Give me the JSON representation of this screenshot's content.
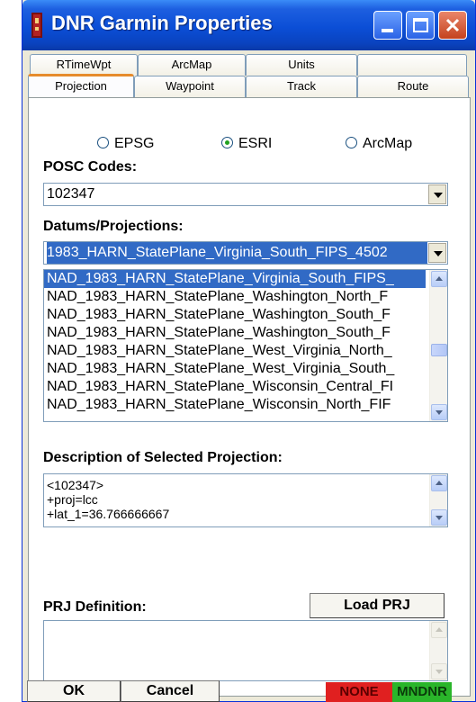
{
  "window": {
    "title": "DNR Garmin Properties"
  },
  "tabs": {
    "back_row": [
      {
        "label": "RTimeWpt"
      },
      {
        "label": "ArcMap"
      },
      {
        "label": "Units"
      },
      {
        "label": ""
      }
    ],
    "front_row": [
      {
        "label": "Projection",
        "active": true
      },
      {
        "label": "Waypoint"
      },
      {
        "label": "Track"
      },
      {
        "label": "Route"
      }
    ]
  },
  "projection": {
    "radio_options": [
      {
        "label": "EPSG",
        "checked": false
      },
      {
        "label": "ESRI",
        "checked": true
      },
      {
        "label": "ArcMap",
        "checked": false
      }
    ],
    "posc_label": "POSC Codes:",
    "posc_value": "102347",
    "datums_label": "Datums/Projections:",
    "datums_value": "1983_HARN_StatePlane_Virginia_South_FIPS_4502",
    "list_items": [
      "NAD_1983_HARN_StatePlane_Virginia_South_FIPS_",
      "NAD_1983_HARN_StatePlane_Washington_North_F",
      "NAD_1983_HARN_StatePlane_Washington_South_F",
      "NAD_1983_HARN_StatePlane_Washington_South_F",
      "NAD_1983_HARN_StatePlane_West_Virginia_North_",
      "NAD_1983_HARN_StatePlane_West_Virginia_South_",
      "NAD_1983_HARN_StatePlane_Wisconsin_Central_FI",
      "NAD_1983_HARN_StatePlane_Wisconsin_North_FIF"
    ],
    "selected_index": 0,
    "description_label": "Description of Selected Projection:",
    "description_lines": [
      "<102347>",
      "+proj=lcc",
      "+lat_1=36.766666667"
    ],
    "prj_label": "PRJ Definition:",
    "load_prj_label": "Load PRJ",
    "prj_value": ""
  },
  "footer": {
    "ok_label": "OK",
    "cancel_label": "Cancel",
    "status_none": "NONE",
    "status_mndnr": "MNDNR"
  },
  "colors": {
    "status_none_bg": "#e02020",
    "status_none_fg": "#5a0000",
    "status_mndnr_bg": "#2ab52a",
    "status_mndnr_fg": "#0a3a0a",
    "selection": "#316ac5",
    "active_tab_accent": "#e68b2c"
  },
  "icons": {
    "app": "garmin-device-icon",
    "minimize": "minimize-icon",
    "maximize": "maximize-icon",
    "close": "close-icon"
  }
}
